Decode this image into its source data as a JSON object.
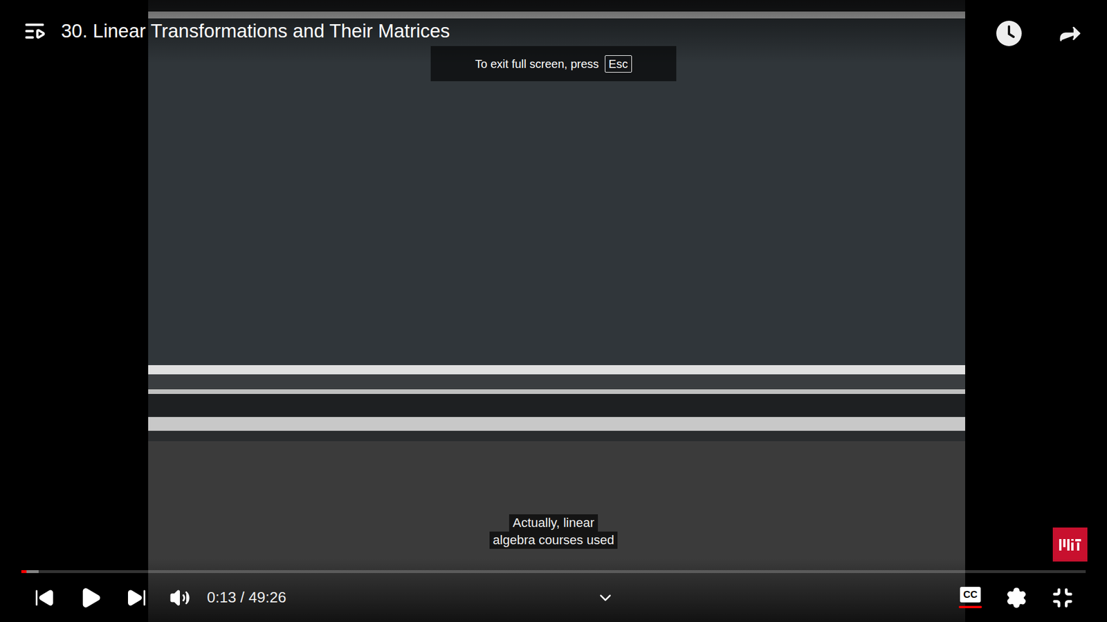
{
  "video": {
    "title": "30. Linear Transformations and Their Matrices"
  },
  "fullscreen_toast": {
    "text": "To exit full screen, press",
    "key": "Esc"
  },
  "captions": [
    "Actually, linear",
    "algebra courses used"
  ],
  "progress": {
    "played": 0.005,
    "buffered": 0.016
  },
  "controls": {
    "time": "0:13 / 49:26",
    "playing": false,
    "cc": {
      "label": "CC",
      "on": true
    },
    "fullscreen": true
  }
}
